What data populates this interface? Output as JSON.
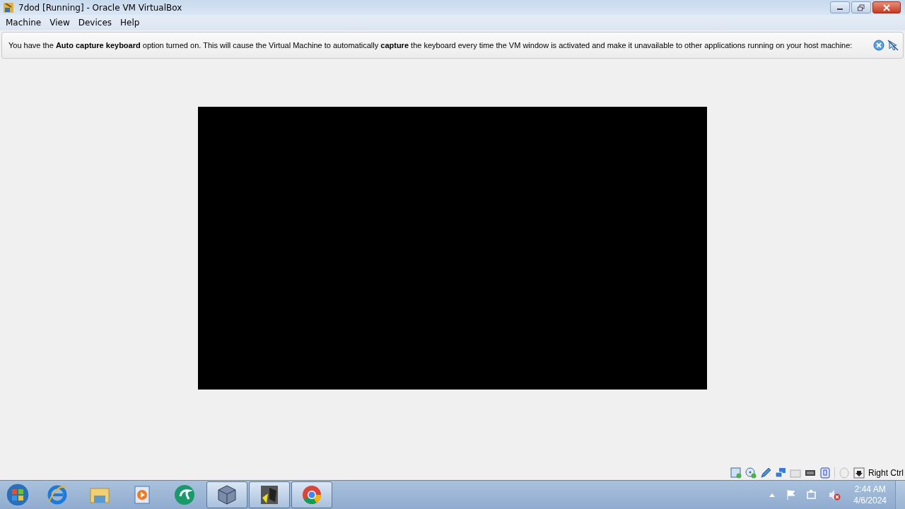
{
  "window": {
    "title": "7dod [Running] - Oracle VM VirtualBox"
  },
  "menu": [
    "Machine",
    "View",
    "Devices",
    "Help"
  ],
  "notice": {
    "text": "You have the **Auto capture keyboard** option turned on. This will cause the Virtual Machine to automatically **capture** the keyboard every time the VM window is activated and make it unavailable to other applications running on your host machine:"
  },
  "status_bar": {
    "host_key": "Right Ctrl"
  },
  "taskbar": {
    "items": [
      {
        "kind": "ie",
        "running": false
      },
      {
        "kind": "folder",
        "running": false
      },
      {
        "kind": "media",
        "running": false
      },
      {
        "kind": "green",
        "running": false
      },
      {
        "kind": "vbox",
        "running": true
      },
      {
        "kind": "app",
        "running": true
      },
      {
        "kind": "chrome",
        "running": true
      }
    ],
    "time": "2:44 AM",
    "date": "4/6/2024"
  }
}
